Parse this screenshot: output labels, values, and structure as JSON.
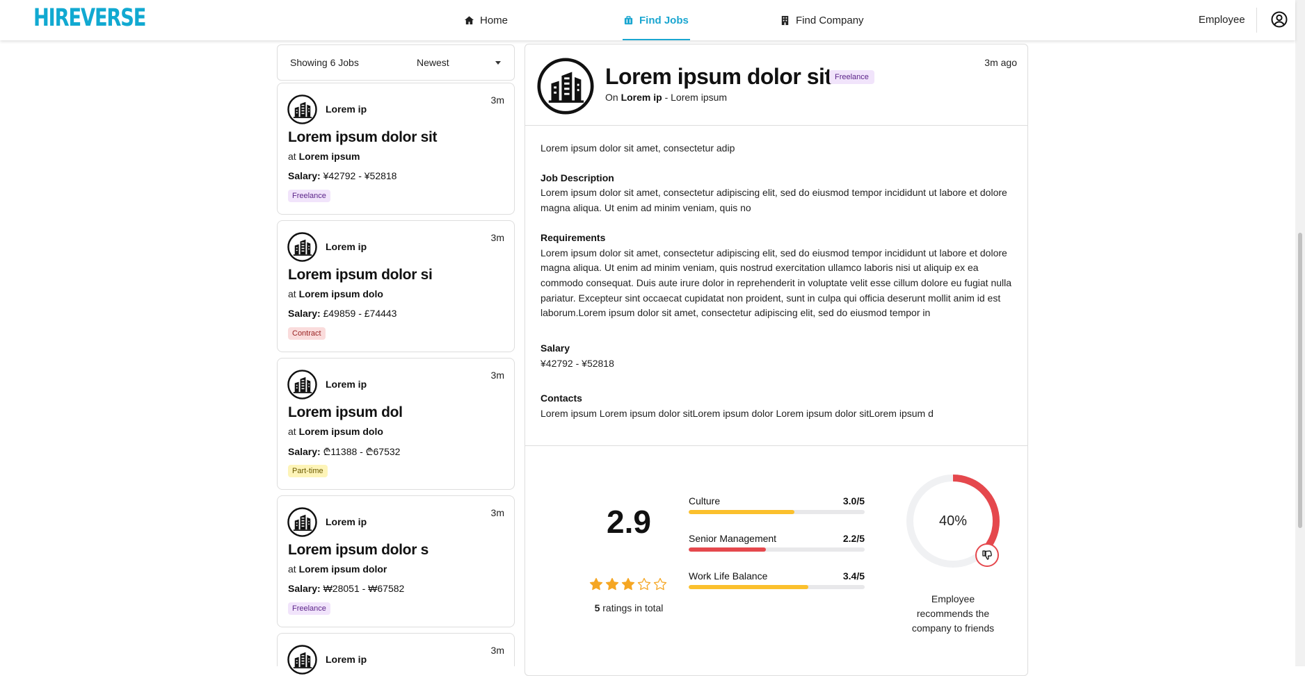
{
  "header": {
    "logo": "HIREVERSE",
    "nav": [
      {
        "label": "Home",
        "icon": "home-icon"
      },
      {
        "label": "Find Jobs",
        "icon": "briefcase-icon"
      },
      {
        "label": "Find Company",
        "icon": "building-icon"
      }
    ],
    "role": "Employee",
    "avatar_icon": "user-circle-icon",
    "accent_color": "#1aa6d0"
  },
  "list": {
    "count_label": "Showing 6 Jobs",
    "sort_value": "Newest",
    "cards": [
      {
        "company": "Lorem ip",
        "time": "3m",
        "title": "Lorem ipsum dolor sit",
        "at_prefix": "at",
        "employer": "Lorem ipsum",
        "salary_label": "Salary:",
        "salary": "¥42792 - ¥52818",
        "tag": "Freelance"
      },
      {
        "company": "Lorem ip",
        "time": "3m",
        "title": "Lorem ipsum dolor si",
        "at_prefix": "at",
        "employer": "Lorem ipsum dolo",
        "salary_label": "Salary:",
        "salary": "£49859 - £74443",
        "tag": "Contract"
      },
      {
        "company": "Lorem ip",
        "time": "3m",
        "title": "Lorem ipsum dol",
        "at_prefix": "at",
        "employer": "Lorem ipsum dolo",
        "salary_label": "Salary:",
        "salary": "₾11388 - ₾67532",
        "tag": "Part-time"
      },
      {
        "company": "Lorem ip",
        "time": "3m",
        "title": "Lorem ipsum dolor s",
        "at_prefix": "at",
        "employer": "Lorem ipsum dolor",
        "salary_label": "Salary:",
        "salary": "₩28051 - ₩67582",
        "tag": "Freelance"
      },
      {
        "company": "Lorem ip",
        "time": "3m"
      }
    ]
  },
  "detail": {
    "title": "Lorem ipsum dolor sit",
    "tag": "Freelance",
    "on_prefix": "On",
    "company": "Lorem ip",
    "location": "- Lorem ipsum",
    "time": "3m ago",
    "summary": "Lorem ipsum dolor sit amet, consectetur adip",
    "job_description_heading": "Job Description",
    "job_description": "Lorem ipsum dolor sit amet, consectetur adipiscing elit, sed do eiusmod tempor incididunt ut labore et dolore magna aliqua. Ut enim ad minim veniam, quis no",
    "requirements_heading": "Requirements",
    "requirements": "Lorem ipsum dolor sit amet, consectetur adipiscing elit, sed do eiusmod tempor incididunt ut labore et dolore magna aliqua. Ut enim ad minim veniam, quis nostrud exercitation ullamco laboris nisi ut aliquip ex ea commodo consequat. Duis aute irure dolor in reprehenderit in voluptate velit esse cillum dolore eu fugiat nulla pariatur. Excepteur sint occaecat cupidatat non proident, sunt in culpa qui officia deserunt mollit anim id est laborum.Lorem ipsum dolor sit amet, consectetur adipiscing elit, sed do eiusmod tempor in",
    "salary_heading": "Salary",
    "salary": "¥42792 - ¥52818",
    "contacts_heading": "Contacts",
    "contacts": "Lorem ipsum Lorem ipsum dolor sitLorem ipsum dolor Lorem ipsum dolor sitLorem ipsum d"
  },
  "ratings": {
    "overall": "2.9",
    "stars_filled": 3,
    "stars_total": 5,
    "total_count": "5",
    "total_suffix": "ratings in total",
    "categories": [
      {
        "label": "Culture",
        "value": "3.0/5",
        "score": 3.0,
        "color": "#fbc02d"
      },
      {
        "label": "Senior Management",
        "value": "2.2/5",
        "score": 2.2,
        "color": "#e5484d"
      },
      {
        "label": "Work Life Balance",
        "value": "3.4/5",
        "score": 3.4,
        "color": "#fbc02d"
      }
    ],
    "recommend_percent": 40,
    "recommend_label": "40%",
    "recommend_text": "Employee recommends the company to friends",
    "recommend_icon": "thumbs-down-icon",
    "recommend_color": "#e5484d"
  }
}
